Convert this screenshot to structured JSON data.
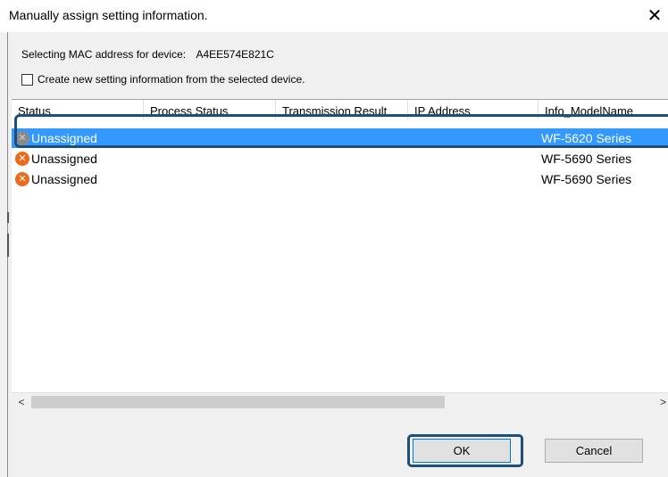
{
  "window": {
    "title": "Manually assign setting information.",
    "close_glyph": "✕"
  },
  "device": {
    "mac_label": "Selecting MAC address for device:",
    "mac_value": "A4EE574E821C"
  },
  "create_new": {
    "label": "Create new setting information from the selected device.",
    "checked": false
  },
  "table": {
    "columns": [
      "Status",
      "Process Status",
      "Transmission Result",
      "IP Address",
      "Info_ModelName"
    ],
    "rows": [
      {
        "status": "Unassigned",
        "status_icon": "x-circle-gray-icon",
        "model": "WF-5620 Series",
        "selected": true
      },
      {
        "status": "Unassigned",
        "status_icon": "x-circle-orange-icon",
        "model": "WF-5690 Series",
        "selected": false
      },
      {
        "status": "Unassigned",
        "status_icon": "x-circle-orange-icon",
        "model": "WF-5690 Series",
        "selected": false
      }
    ]
  },
  "scrollbar": {
    "left_arrow": "<",
    "right_arrow": ">"
  },
  "buttons": {
    "ok": "OK",
    "cancel": "Cancel"
  },
  "colors": {
    "selection": "#3399ff",
    "highlight_frame": "#1d4f7d",
    "status_error": "#ec6a1c"
  }
}
